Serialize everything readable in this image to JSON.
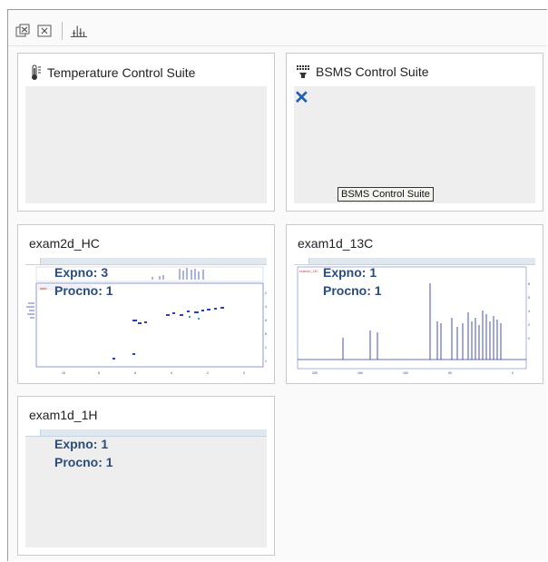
{
  "toolbar": {
    "icons": [
      "tile-windows-icon",
      "close-windows-icon",
      "spectrum-peaks-icon"
    ]
  },
  "cards": {
    "temp": {
      "title": "Temperature Control Suite",
      "icon": "thermometer-icon"
    },
    "bsms": {
      "title": "BSMS Control Suite",
      "icon": "bsms-icon",
      "tooltip": "BSMS Control Suite"
    },
    "hc": {
      "title": "exam2d_HC",
      "expno": "Expno: 3",
      "procno": "Procno: 1"
    },
    "c13": {
      "title": "exam1d_13C",
      "expno": "Expno: 1",
      "procno": "Procno: 1"
    },
    "h1": {
      "title": "exam1d_1H",
      "expno": "Expno: 1",
      "procno": "Procno: 1"
    }
  },
  "colors": {
    "accent": "#1f5fb3",
    "spectrum": "#2d3fb8",
    "label": "#2a4d7d"
  }
}
